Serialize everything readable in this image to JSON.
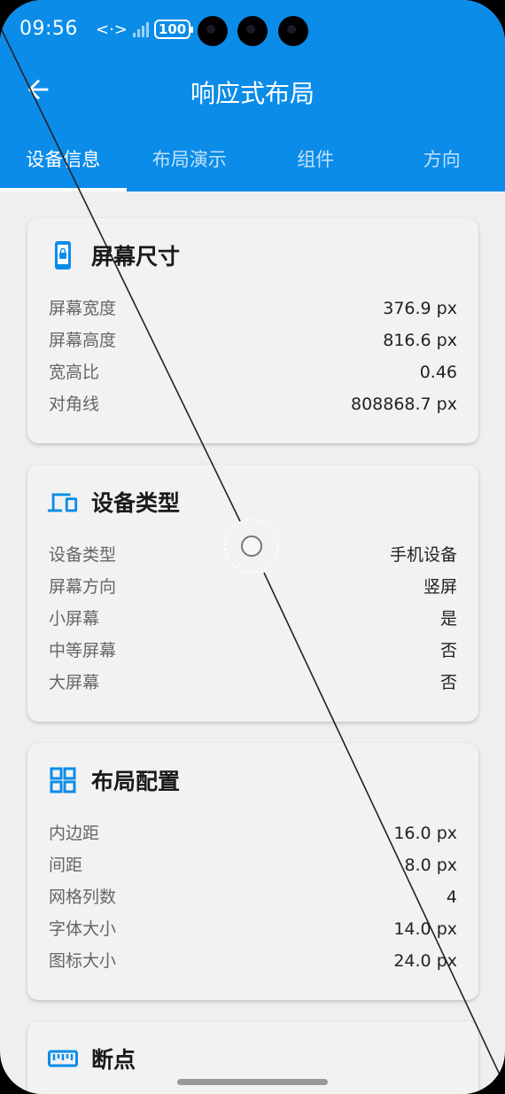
{
  "status_bar": {
    "time": "09:56",
    "network": "<·>",
    "battery": "100"
  },
  "toolbar": {
    "title": "响应式布局",
    "back_icon": "arrow-left-icon"
  },
  "tabs": [
    {
      "label": "设备信息",
      "active": true
    },
    {
      "label": "布局演示",
      "active": false
    },
    {
      "label": "组件",
      "active": false
    },
    {
      "label": "方向",
      "active": false
    }
  ],
  "cards": {
    "screen_size": {
      "title": "屏幕尺寸",
      "icon": "phone-lock-icon",
      "rows": [
        {
          "k": "屏幕宽度",
          "v": "376.9 px"
        },
        {
          "k": "屏幕高度",
          "v": "816.6 px"
        },
        {
          "k": "宽高比",
          "v": "0.46"
        },
        {
          "k": "对角线",
          "v": "808868.7 px"
        }
      ]
    },
    "device_type": {
      "title": "设备类型",
      "icon": "devices-icon",
      "rows": [
        {
          "k": "设备类型",
          "v": "手机设备"
        },
        {
          "k": "屏幕方向",
          "v": "竖屏"
        },
        {
          "k": "小屏幕",
          "v": "是"
        },
        {
          "k": "中等屏幕",
          "v": "否"
        },
        {
          "k": "大屏幕",
          "v": "否"
        }
      ]
    },
    "layout_config": {
      "title": "布局配置",
      "icon": "grid-icon",
      "rows": [
        {
          "k": "内边距",
          "v": "16.0 px"
        },
        {
          "k": "间距",
          "v": "8.0 px"
        },
        {
          "k": "网格列数",
          "v": "4"
        },
        {
          "k": "字体大小",
          "v": "14.0 px"
        },
        {
          "k": "图标大小",
          "v": "24.0 px"
        }
      ]
    },
    "breakpoints": {
      "title": "断点",
      "icon": "ruler-icon"
    }
  },
  "colors": {
    "primary": "#0b8ce9",
    "background": "#efefef",
    "card": "#f2f2f2"
  }
}
